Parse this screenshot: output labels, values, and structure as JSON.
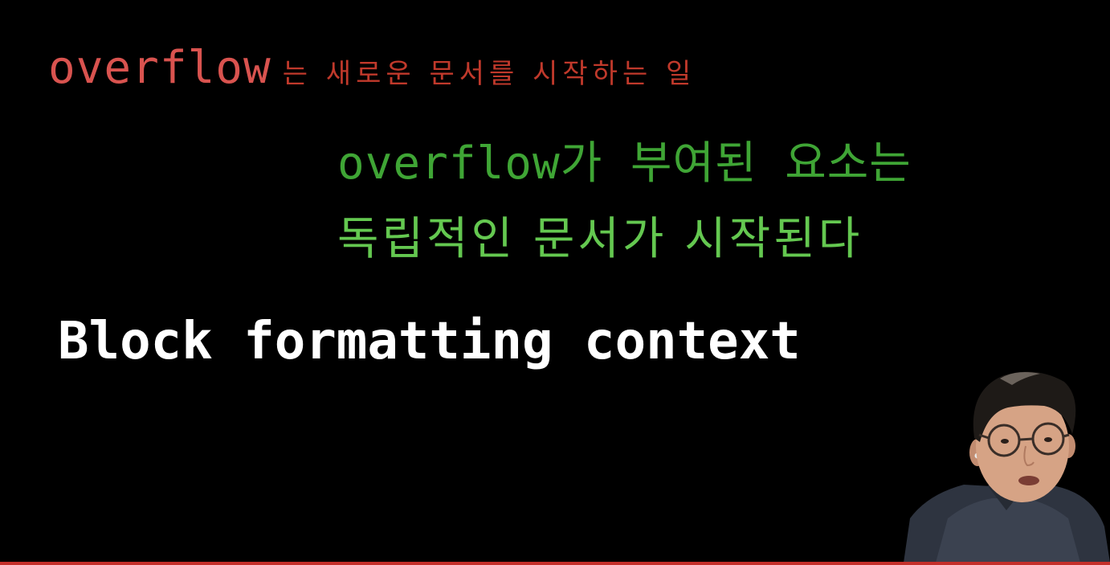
{
  "slide": {
    "line1_keyword": "overflow",
    "line1_rest": "는 새로운 문서를 시작하는 일",
    "line2": "overflow가 부여된 요소는",
    "line3": "독립적인 문서가 시작된다",
    "line4": "Block formatting context"
  },
  "colors": {
    "background": "#000000",
    "red_keyword": "#d9534f",
    "red_text": "#c0392b",
    "green_dark": "#3fa535",
    "green_light": "#64c850",
    "white": "#ffffff",
    "progress_bar": "#c4302b"
  }
}
